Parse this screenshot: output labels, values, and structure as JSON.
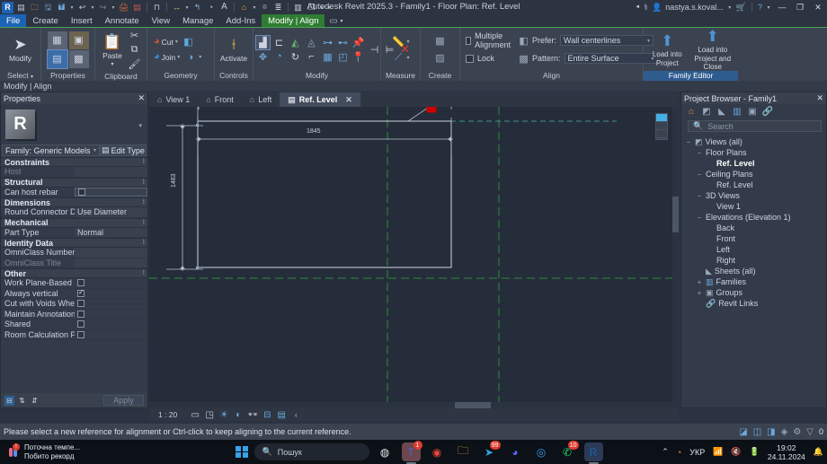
{
  "titlebar": {
    "app_button": "R",
    "title": "Autodesk Revit 2025.3 - Family1 - Floor Plan: Ref. Level",
    "user": "nastya.s.koval...",
    "qat": [
      {
        "name": "open-from-cloud-icon",
        "glyph": "▤"
      },
      {
        "name": "open-icon",
        "glyph": "📂"
      },
      {
        "name": "save-icon",
        "glyph": "💾"
      },
      {
        "name": "save-as-icon",
        "glyph": "🖫"
      },
      {
        "name": "undo-icon",
        "glyph": "↶"
      },
      {
        "name": "redo-icon",
        "glyph": "↷"
      },
      {
        "name": "print-icon",
        "glyph": "🖨"
      },
      {
        "name": "measure-icon",
        "glyph": "🗒"
      },
      {
        "name": "align-dim-icon",
        "glyph": "⊣"
      },
      {
        "name": "dimension-icon",
        "glyph": "↔"
      },
      {
        "name": "tag-icon",
        "glyph": "⌁"
      },
      {
        "name": "paint-icon",
        "glyph": "◉"
      },
      {
        "name": "text-icon",
        "glyph": "A"
      },
      {
        "name": "default-3d-icon",
        "glyph": "⌂"
      },
      {
        "name": "section-icon",
        "glyph": "⌾"
      },
      {
        "name": "thin-lines-icon",
        "glyph": "≣"
      },
      {
        "name": "close-hidden-icon",
        "glyph": "▥"
      },
      {
        "name": "switch-windows-icon",
        "glyph": "❐"
      }
    ],
    "window_controls": {
      "minimize": "—",
      "maximize": "❐",
      "close": "✕"
    }
  },
  "ribbon_tabs": [
    {
      "label": "File",
      "state": "file"
    },
    {
      "label": "Create",
      "state": "normal"
    },
    {
      "label": "Insert",
      "state": "normal"
    },
    {
      "label": "Annotate",
      "state": "normal"
    },
    {
      "label": "View",
      "state": "normal"
    },
    {
      "label": "Manage",
      "state": "normal"
    },
    {
      "label": "Add-Ins",
      "state": "normal"
    },
    {
      "label": "Modify | Align",
      "state": "active"
    }
  ],
  "ribbon": {
    "select_panel": {
      "label": "Select",
      "modify_label": "Modify"
    },
    "properties_panel": {
      "label": "Properties",
      "buttons": [
        "properties-tile",
        "type-properties-tile",
        "family-category-tile",
        "family-types-tile"
      ]
    },
    "clipboard_panel": {
      "label": "Clipboard",
      "paste_label": "Paste",
      "cut_label": "Cut",
      "copy_label": "Copy",
      "match_label": "Match Type"
    },
    "geometry_panel": {
      "label": "Geometry",
      "cut_label": "Cut",
      "join_label": "Join"
    },
    "controls_panel": {
      "label": "Controls",
      "activate_label": "Activate"
    },
    "modify_panel": {
      "label": "Modify",
      "tools": [
        "align-tool",
        "offset-tool",
        "mirror-pick-axis-tool",
        "mirror-draw-axis-tool",
        "move-tool",
        "copy-tool",
        "rotate-tool",
        "trim-extend-corner-tool",
        "array-tool",
        "scale-tool",
        "split-tool",
        "pin-tool",
        "unpin-tool",
        "trim-single-tool",
        "trim-multiple-tool",
        "delete-tool"
      ]
    },
    "measure_panel": {
      "label": "Measure"
    },
    "create_panel": {
      "label": "Create"
    },
    "align_panel": {
      "label": "Align",
      "multiple_alignment_label": "Multiple Alignment",
      "multiple_alignment_checked": false,
      "lock_label": "Lock",
      "lock_checked": false,
      "prefer_label": "Prefer:",
      "prefer_value": "Wall centerlines",
      "pattern_label": "Pattern:",
      "pattern_value": "Entire Surface"
    },
    "family_editor_panel": {
      "label": "Family Editor",
      "load_into_project": "Load into\nProject",
      "load_into_project_line1": "Load into",
      "load_into_project_line2": "Project",
      "load_into_project_close_line1": "Load into",
      "load_into_project_close_line2": "Project and Close"
    }
  },
  "context_line": "Modify | Align",
  "properties": {
    "title": "Properties",
    "close_icon": "✕",
    "type_selector": "Family: Generic Models",
    "edit_type_label": "Edit Type",
    "groups": [
      {
        "name": "Constraints",
        "rows": [
          {
            "key": "Host",
            "value": "",
            "kind": "text",
            "dim": true
          }
        ]
      },
      {
        "name": "Structural",
        "rows": [
          {
            "key": "Can host rebar",
            "value": "",
            "kind": "checkbox",
            "checked": false,
            "boxed": true
          }
        ]
      },
      {
        "name": "Dimensions",
        "rows": [
          {
            "key": "Round Connector Dim...",
            "value": "Use Diameter",
            "kind": "text"
          }
        ]
      },
      {
        "name": "Mechanical",
        "rows": [
          {
            "key": "Part Type",
            "value": "Normal",
            "kind": "text"
          }
        ]
      },
      {
        "name": "Identity Data",
        "rows": [
          {
            "key": "OmniClass Number",
            "value": "",
            "kind": "text"
          },
          {
            "key": "OmniClass Title",
            "value": "",
            "kind": "text",
            "dim": true
          }
        ]
      },
      {
        "name": "Other",
        "rows": [
          {
            "key": "Work Plane-Based",
            "value": "",
            "kind": "checkbox",
            "checked": false
          },
          {
            "key": "Always vertical",
            "value": "",
            "kind": "checkbox",
            "checked": true
          },
          {
            "key": "Cut with Voids When L...",
            "value": "",
            "kind": "checkbox",
            "checked": false
          },
          {
            "key": "Maintain Annotation ...",
            "value": "",
            "kind": "checkbox",
            "checked": false
          },
          {
            "key": "Shared",
            "value": "",
            "kind": "checkbox",
            "checked": false
          },
          {
            "key": "Room Calculation Point",
            "value": "",
            "kind": "checkbox",
            "checked": false
          }
        ]
      }
    ],
    "apply_label": "Apply"
  },
  "view_tabs": [
    {
      "label": "View 1",
      "icon": "3d-view-icon",
      "active": false
    },
    {
      "label": "Front",
      "icon": "elevation-icon",
      "active": false
    },
    {
      "label": "Left",
      "icon": "elevation-icon",
      "active": false
    },
    {
      "label": "Ref. Level",
      "icon": "floor-plan-icon",
      "active": true,
      "close": "✕"
    }
  ],
  "canvas": {
    "dimension_horizontal": "1845",
    "dimension_vertical": "1483",
    "lock_icon": "lock-icon",
    "lock_color": "#cc0000",
    "reference_plane_color": "#2d8a3e",
    "geometry_color": "#cfd5de"
  },
  "view_control_bar": {
    "scale": "1 : 20",
    "icons": [
      "detail-level-icon",
      "visual-style-icon",
      "sun-path-icon",
      "shadows-icon",
      "render-icon",
      "crop-view-icon",
      "crop-region-icon",
      "temp-hide-isolate-icon",
      "analytical-model-icon"
    ],
    "more": "‹"
  },
  "project_browser": {
    "title": "Project Browser - Family1",
    "close_icon": "✕",
    "toolbar_icons": [
      "home-icon",
      "views-icon",
      "sheets-icon",
      "families-icon",
      "groups-icon",
      "links-icon"
    ],
    "search_placeholder": "Search",
    "search_icon": "search-icon",
    "tree": [
      {
        "label": "Views (all)",
        "depth": 0,
        "toggle": "−",
        "icon": "views-icon",
        "bold": false
      },
      {
        "label": "Floor Plans",
        "depth": 1,
        "toggle": "−",
        "icon": "",
        "bold": false
      },
      {
        "label": "Ref. Level",
        "depth": 2,
        "toggle": "",
        "icon": "",
        "bold": true
      },
      {
        "label": "Ceiling Plans",
        "depth": 1,
        "toggle": "−",
        "icon": "",
        "bold": false
      },
      {
        "label": "Ref. Level",
        "depth": 2,
        "toggle": "",
        "icon": "",
        "bold": false
      },
      {
        "label": "3D Views",
        "depth": 1,
        "toggle": "−",
        "icon": "",
        "bold": false
      },
      {
        "label": "View 1",
        "depth": 2,
        "toggle": "",
        "icon": "",
        "bold": false
      },
      {
        "label": "Elevations (Elevation 1)",
        "depth": 1,
        "toggle": "−",
        "icon": "",
        "bold": false
      },
      {
        "label": "Back",
        "depth": 2,
        "toggle": "",
        "icon": "",
        "bold": false
      },
      {
        "label": "Front",
        "depth": 2,
        "toggle": "",
        "icon": "",
        "bold": false
      },
      {
        "label": "Left",
        "depth": 2,
        "toggle": "",
        "icon": "",
        "bold": false
      },
      {
        "label": "Right",
        "depth": 2,
        "toggle": "",
        "icon": "",
        "bold": false
      },
      {
        "label": "Sheets (all)",
        "depth": 1,
        "toggle": "",
        "icon": "sheets-icon",
        "bold": false
      },
      {
        "label": "Families",
        "depth": 1,
        "toggle": "+",
        "icon": "families-icon",
        "bold": false
      },
      {
        "label": "Groups",
        "depth": 1,
        "toggle": "+",
        "icon": "groups-icon",
        "bold": false
      },
      {
        "label": "Revit Links",
        "depth": 1,
        "toggle": "",
        "icon": "links-icon",
        "bold": false
      }
    ]
  },
  "status_bar": {
    "message": "Please select a new reference for alignment or Ctrl-click to keep aligning to the current reference.",
    "filter_count": "0"
  },
  "taskbar": {
    "weather_line1": "Поточна темпе...",
    "weather_line2": "Побито рекорд",
    "search_placeholder": "Пошук",
    "apps": [
      {
        "name": "copilot-icon",
        "glyph": "◍",
        "color": "#e8e8ea",
        "badge": "",
        "active": false
      },
      {
        "name": "teams-icon",
        "glyph": "T",
        "color": "#5b5fc7",
        "badge": "1",
        "active": true
      },
      {
        "name": "chrome-icon",
        "glyph": "◉",
        "color": "#e8453c",
        "badge": "",
        "active": false
      },
      {
        "name": "file-explorer-icon",
        "glyph": "🗀",
        "color": "#f6b93b",
        "badge": "",
        "active": false
      },
      {
        "name": "telegram-icon",
        "glyph": "➤",
        "color": "#2ca5e0",
        "badge": "99",
        "active": false
      },
      {
        "name": "discord-icon",
        "glyph": "◕",
        "color": "#5865f2",
        "badge": "",
        "active": false
      },
      {
        "name": "edge-icon",
        "glyph": "◎",
        "color": "#3aa0e8",
        "badge": "",
        "active": false
      },
      {
        "name": "whatsapp-icon",
        "glyph": "✆",
        "color": "#25d366",
        "badge": "10",
        "active": false
      },
      {
        "name": "revit-icon",
        "glyph": "R",
        "color": "#1b63b5",
        "badge": "",
        "active": true
      }
    ],
    "tray": {
      "chevron": "⌃",
      "language": "УКР",
      "wifi": "◗",
      "volume": "🔇",
      "battery": "▭",
      "time": "19:02",
      "date": "24.11.2024",
      "notification": "🔔"
    }
  }
}
